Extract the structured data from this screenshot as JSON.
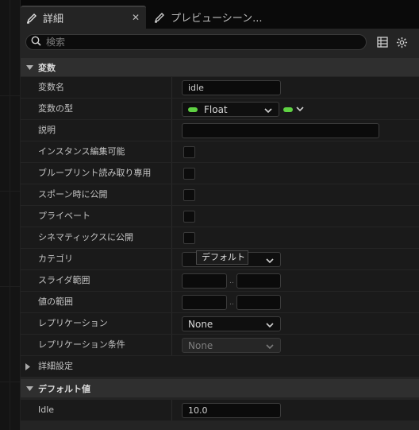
{
  "tabs": [
    {
      "label": "詳細",
      "icon": "pencil-icon",
      "active": true
    },
    {
      "label": "プレビューシーン...",
      "icon": "pencil-icon",
      "active": false
    }
  ],
  "search": {
    "placeholder": "検索"
  },
  "sections": {
    "variables": "変数",
    "default_value": "デフォルト値"
  },
  "variables": {
    "name_label": "変数名",
    "name_value": "idle",
    "type_label": "変数の型",
    "type_value": "Float",
    "description_label": "説明",
    "description_value": "",
    "instance_editable_label": "インスタンス編集可能",
    "blueprint_readonly_label": "ブループリント読み取り専用",
    "expose_on_spawn_label": "スポーン時に公開",
    "private_label": "プライベート",
    "expose_cinematics_label": "シネマティックスに公開",
    "category_label": "カテゴリ",
    "category_value": "デフォルト",
    "slider_range_label": "スライダ範囲",
    "value_range_label": "値の範囲",
    "range_separator": "..",
    "replication_label": "レプリケーション",
    "replication_value": "None",
    "replication_condition_label": "レプリケーション条件",
    "replication_condition_value": "None",
    "advanced_label": "詳細設定"
  },
  "default_value": {
    "label": "Idle",
    "value": "10.0"
  },
  "colors": {
    "float_pin": "#5fd243",
    "panel_bg": "#242424",
    "row_bg": "#1a1a1a"
  }
}
